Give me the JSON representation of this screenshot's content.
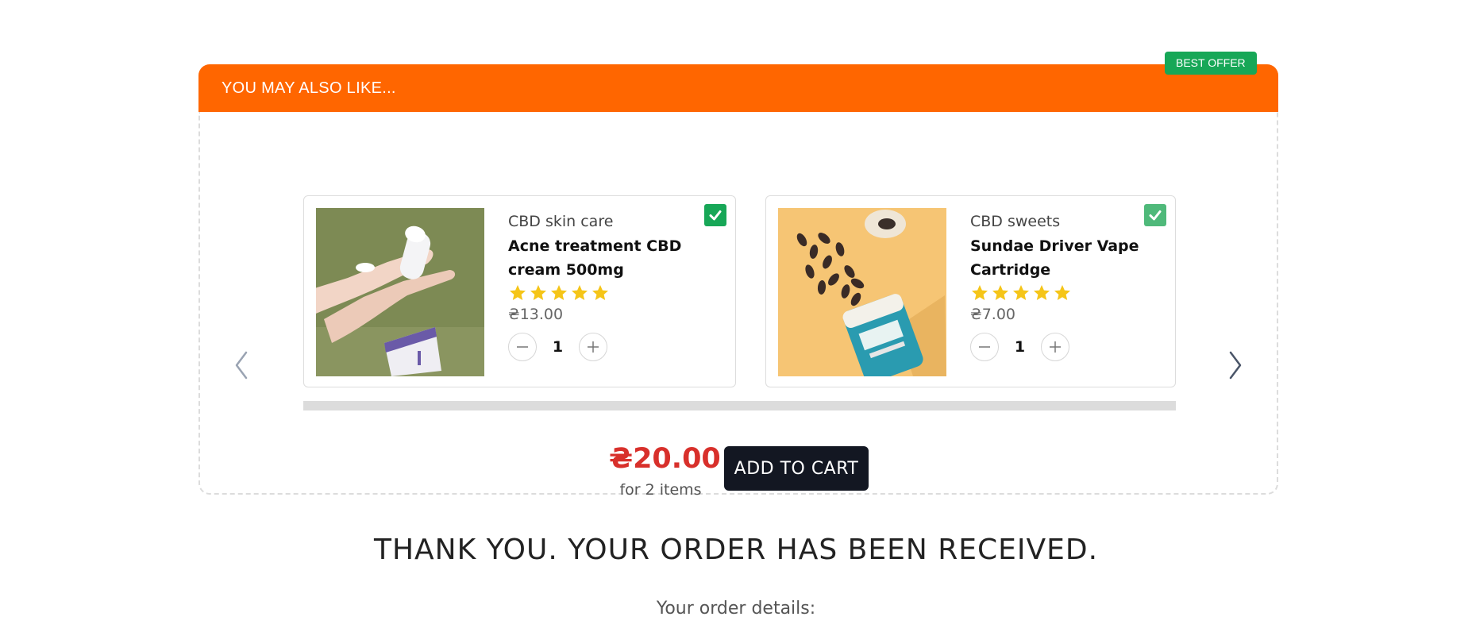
{
  "widget": {
    "title": "YOU MAY ALSO LIKE...",
    "badge": "BEST OFFER",
    "header_color": "#ff6600",
    "badge_color": "#17a757",
    "products": [
      {
        "category": "CBD skin care",
        "name": "Acne treatment CBD cream 500mg",
        "rating": 5,
        "price": "₴13.00",
        "quantity": "1",
        "selected": true,
        "image_icon": "hand-cream-photo"
      },
      {
        "category": "CBD sweets",
        "name": "Sundae Driver Vape Cartridge",
        "rating": 5,
        "price": "₴7.00",
        "quantity": "1",
        "selected": true,
        "image_icon": "capsules-bottle-photo"
      }
    ],
    "total_price": "₴20.00",
    "total_note": "for 2 items",
    "add_to_cart_label": "ADD TO CART",
    "star_color": "#f5c518",
    "price_color": "#d8302b"
  },
  "page": {
    "thank_you": "THANK YOU. YOUR ORDER HAS BEEN RECEIVED.",
    "order_details": "Your order details:"
  }
}
